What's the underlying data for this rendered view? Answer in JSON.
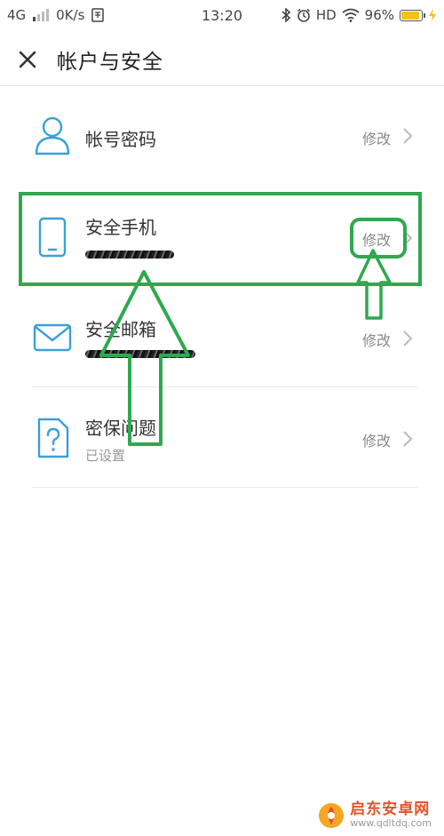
{
  "status_bar": {
    "network": "4G",
    "speed": "0K/s",
    "time": "13:20",
    "hd": "HD",
    "battery_text": "96%",
    "battery_level": 0.96,
    "icons": [
      "signal-icon",
      "sim-icon",
      "bluetooth-icon",
      "alarm-icon",
      "wifi-icon",
      "battery-icon",
      "charging-icon"
    ]
  },
  "header": {
    "title": "帐户与安全",
    "close_icon": "close-icon"
  },
  "items": [
    {
      "title": "帐号密码",
      "subtitle": "",
      "action": "修改",
      "icon": "user-icon"
    },
    {
      "title": "安全手机",
      "subtitle": "",
      "action": "修改",
      "icon": "phone-icon"
    },
    {
      "title": "安全邮箱",
      "subtitle": "",
      "action": "修改",
      "icon": "mail-icon"
    },
    {
      "title": "密保问题",
      "subtitle": "已设置",
      "action": "修改",
      "icon": "question-icon"
    }
  ],
  "annotation": {
    "color": "#2fa84f"
  },
  "colors": {
    "accent": "#3aa0d8",
    "action_text": "#888888",
    "watermark": "#e0532a"
  },
  "watermark": {
    "name": "启东安卓网",
    "url": "www.qdltdq.com"
  }
}
